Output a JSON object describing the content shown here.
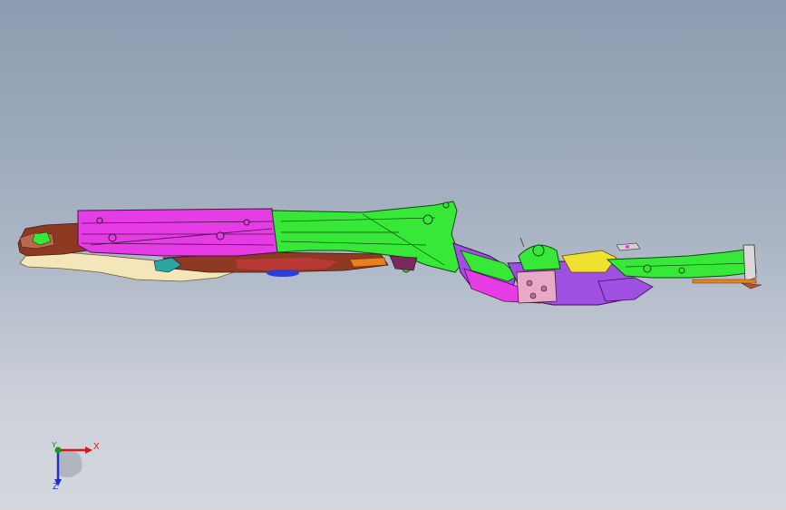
{
  "viewport": {
    "background_top": "#8c9bb0",
    "background_bottom": "#d6d8de"
  },
  "model": {
    "part_colors": {
      "green": "#38e838",
      "magenta": "#e63ce6",
      "cream": "#f3e6b8",
      "brown": "#8e3a22",
      "purple": "#a050e0",
      "yellow": "#f0e030",
      "blue": "#2b3ed8",
      "orange": "#e88020"
    }
  },
  "triad": {
    "x_label": "X",
    "y_label": "Y",
    "z_label": "Z",
    "x_color": "#d61818",
    "y_color": "#1a9a1a",
    "z_color": "#2030c8"
  }
}
